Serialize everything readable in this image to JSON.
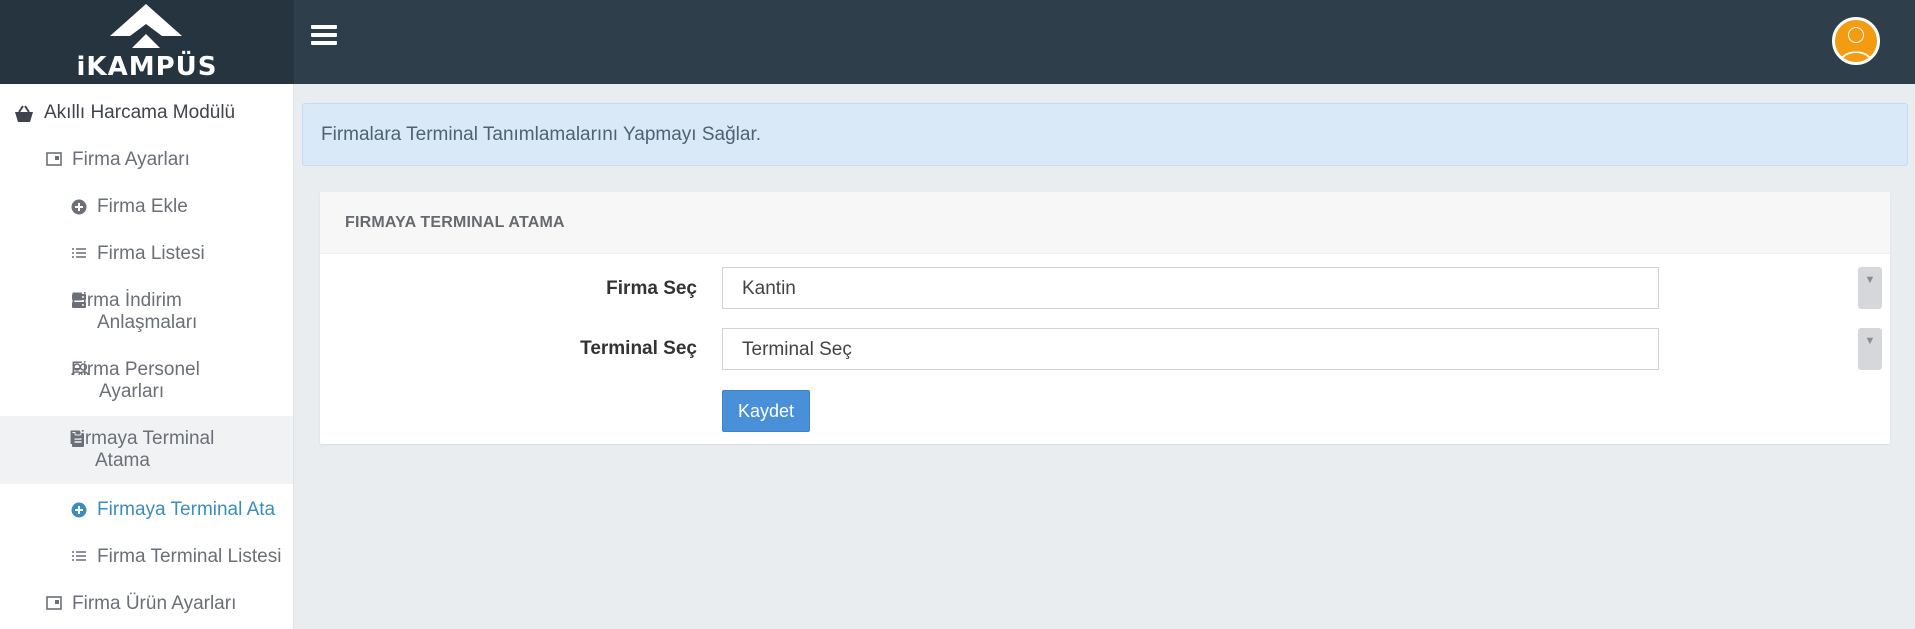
{
  "header": {
    "logo_text": "iKAMPÜS",
    "menu_icon": "hamburger-icon",
    "avatar_icon": "user-avatar-icon",
    "colors": {
      "bar": "#2f3e4b",
      "logo_bg": "#263440",
      "avatar": "#f39c12"
    }
  },
  "sidebar": {
    "module": {
      "label": "Akıllı Harcama Modülü",
      "icon": "basket-icon"
    },
    "items": [
      {
        "label": "Firma Ayarları",
        "icon": "window-icon"
      },
      {
        "label": "Firma Ekle",
        "icon": "plus-circle-icon"
      },
      {
        "label": "Firma Listesi",
        "icon": "list-icon"
      },
      {
        "label": "Firma İndirim Anlaşmaları",
        "icon": "server-icon"
      },
      {
        "label": "Firma Personel Ayarları",
        "icon": "users-icon"
      },
      {
        "label": "Firmaya Terminal Atama",
        "icon": "clipboard-icon"
      },
      {
        "label": "Firmaya Terminal Ata",
        "icon": "plus-circle-icon"
      },
      {
        "label": "Firma Terminal Listesi",
        "icon": "list-icon"
      },
      {
        "label": "Firma Ürün Ayarları",
        "icon": "window-icon"
      }
    ],
    "accent_color": "#3c8dbc"
  },
  "main": {
    "info_text": "Firmalara Terminal Tanımlamalarını Yapmayı Sağlar.",
    "panel_title": "FIRMAYA TERMINAL ATAMA",
    "form": {
      "firma_label": "Firma Seç",
      "firma_value": "Kantin",
      "terminal_label": "Terminal Seç",
      "terminal_value": "Terminal Seç",
      "save_label": "Kaydet"
    },
    "colors": {
      "info_bg": "#d9e9f7",
      "button": "#4a90d9"
    }
  }
}
